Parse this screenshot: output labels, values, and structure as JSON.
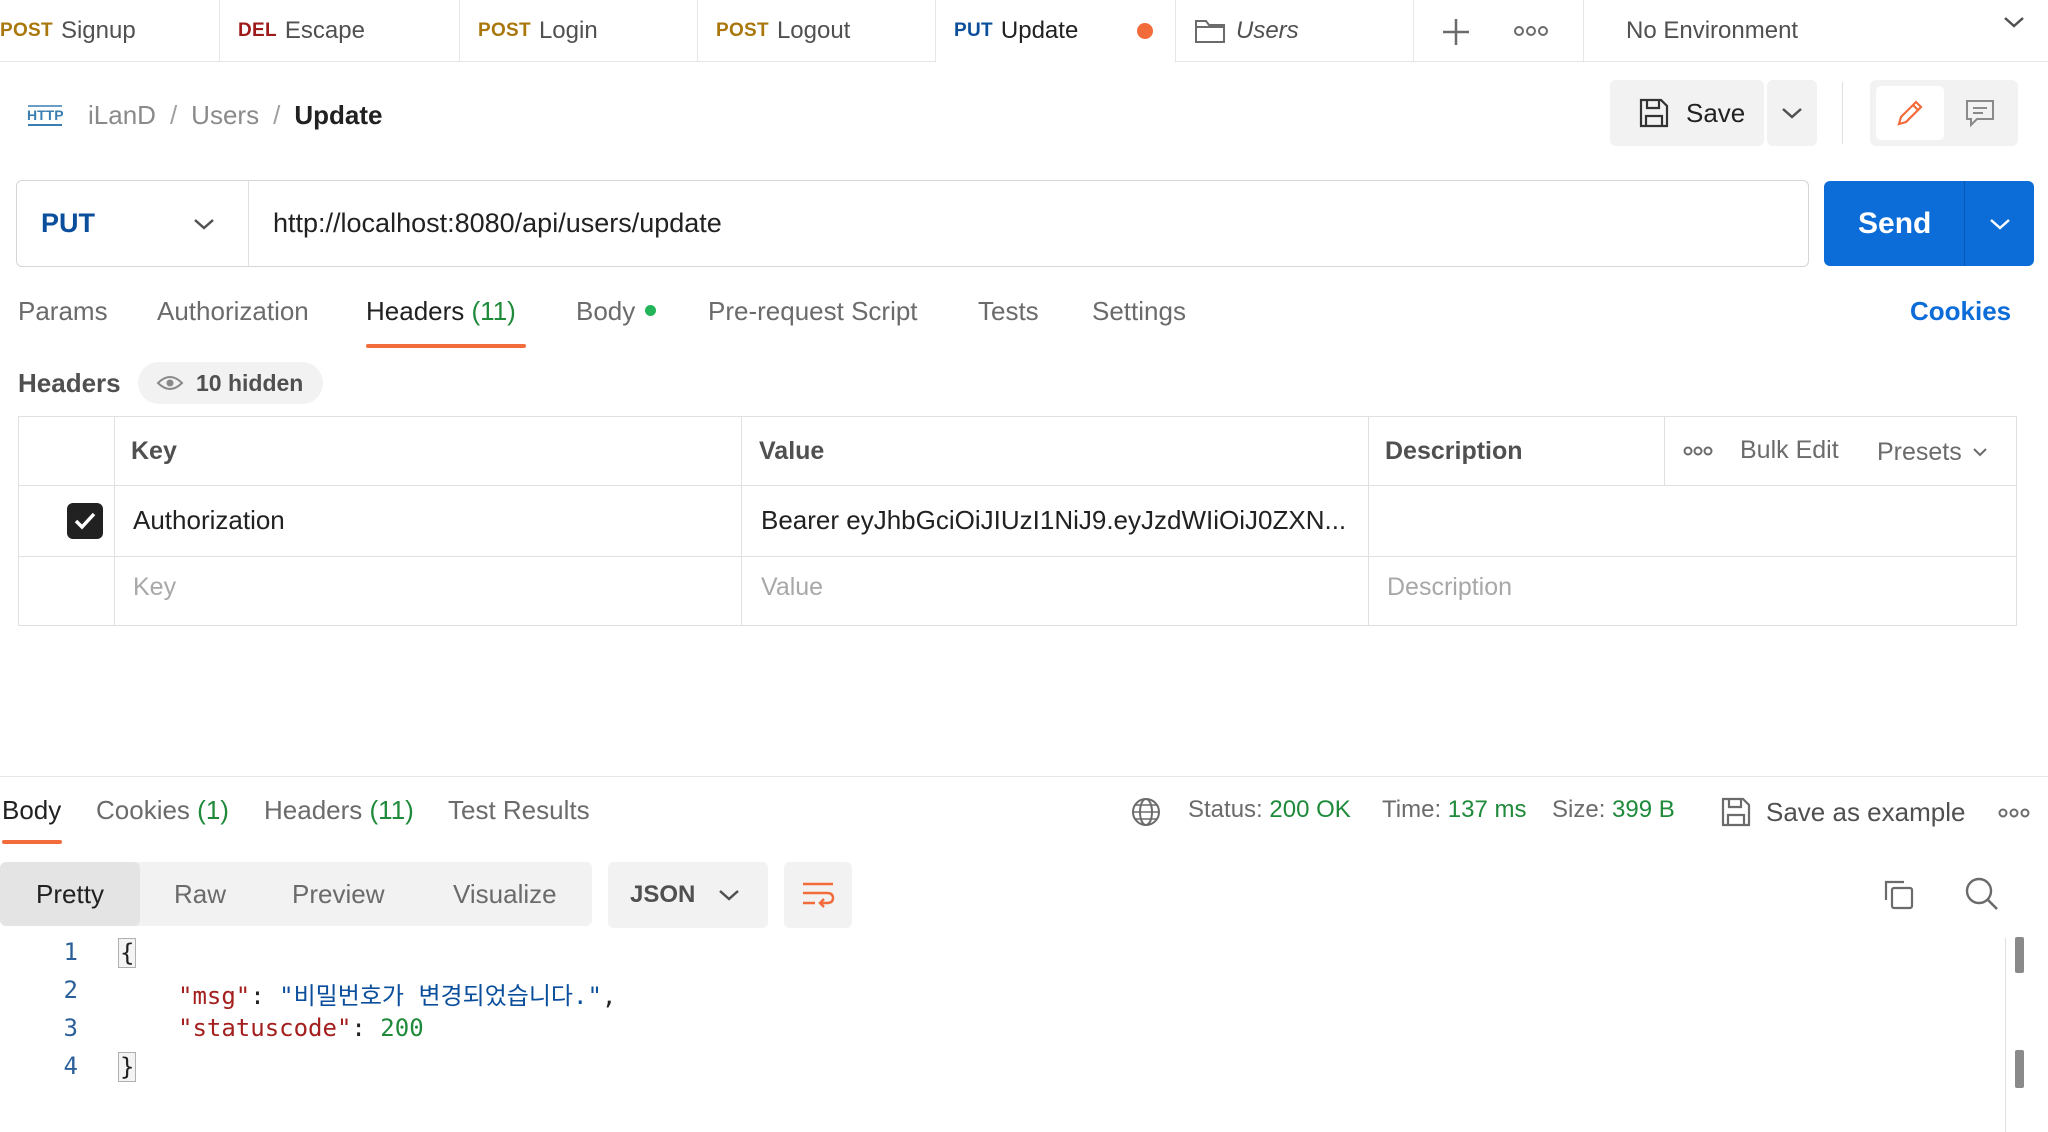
{
  "tabs": [
    {
      "method": "POST",
      "label": "Signup"
    },
    {
      "method": "DEL",
      "label": "Escape"
    },
    {
      "method": "POST",
      "label": "Login"
    },
    {
      "method": "POST",
      "label": "Logout"
    },
    {
      "method": "PUT",
      "label": "Update"
    }
  ],
  "folder_tab": {
    "label": "Users"
  },
  "environment": {
    "label": "No Environment"
  },
  "breadcrumb": {
    "workspace": "iLanD",
    "collection": "Users",
    "request": "Update",
    "separator": "/"
  },
  "toolbar": {
    "save_label": "Save"
  },
  "request": {
    "method": "PUT",
    "url": "http://localhost:8080/api/users/update",
    "send_label": "Send"
  },
  "request_tabs": {
    "params": "Params",
    "authorization": "Authorization",
    "headers": "Headers",
    "headers_count": "(11)",
    "body": "Body",
    "pre_request": "Pre-request Script",
    "tests": "Tests",
    "settings": "Settings",
    "cookies": "Cookies"
  },
  "headers_section": {
    "title": "Headers",
    "hidden_label": "10 hidden"
  },
  "headers_table": {
    "columns": {
      "key": "Key",
      "value": "Value",
      "description": "Description"
    },
    "bulk_edit": "Bulk Edit",
    "presets": "Presets",
    "rows": [
      {
        "checked": true,
        "key": "Authorization",
        "value": "Bearer eyJhbGciOiJIUzI1NiJ9.eyJzdWIiOiJ0ZXN...",
        "description": ""
      }
    ],
    "placeholder": {
      "key": "Key",
      "value": "Value",
      "description": "Description"
    }
  },
  "response": {
    "tabs": {
      "body": "Body",
      "cookies": "Cookies",
      "cookies_count": "(1)",
      "headers": "Headers",
      "headers_count": "(11)",
      "test_results": "Test Results"
    },
    "status_label": "Status:",
    "status_value": "200 OK",
    "time_label": "Time:",
    "time_value": "137 ms",
    "size_label": "Size:",
    "size_value": "399 B",
    "save_example": "Save as example",
    "views": [
      "Pretty",
      "Raw",
      "Preview",
      "Visualize"
    ],
    "format": "JSON",
    "code": {
      "line_numbers": [
        "1",
        "2",
        "3",
        "4"
      ],
      "open_brace": "{",
      "close_brace": "}",
      "msg_key": "\"msg\"",
      "msg_value": "\"비밀번호가 변경되었습니다.\"",
      "status_key": "\"statuscode\"",
      "status_value": "200"
    }
  },
  "colors": {
    "accent": "#f26b3a",
    "send": "#0c6cd8",
    "put": "#0b4f9c",
    "post": "#a9770c",
    "delete": "#9e1b1b",
    "success": "#1f8a3a"
  }
}
